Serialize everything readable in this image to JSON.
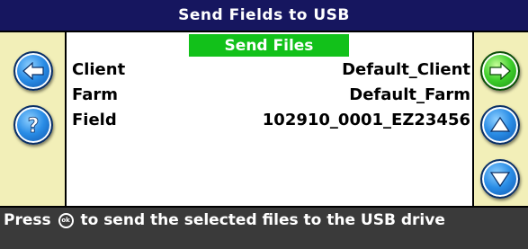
{
  "window": {
    "title": "Send Fields to USB"
  },
  "tab": {
    "label": "Send Files"
  },
  "rows": [
    {
      "label": "Client",
      "value": "Default_Client"
    },
    {
      "label": "Farm",
      "value": "Default_Farm"
    },
    {
      "label": "Field",
      "value": "102910_0001_EZ23456"
    }
  ],
  "status": {
    "text_before": "Press",
    "ok_icon_text": "ok",
    "text_after": "to send the selected files to the USB drive"
  },
  "buttons": {
    "back_icon": "arrow-left-icon",
    "help_icon": "question-mark-icon",
    "confirm_icon": "arrow-right-icon",
    "up_icon": "arrow-up-icon",
    "down_icon": "arrow-down-icon"
  },
  "colors": {
    "title_bar": "#16165f",
    "side_panel": "#f2efb8",
    "tab_green": "#12c11a",
    "status_bar": "#3a3a3a",
    "button_blue": "#2a8de6",
    "button_green": "#3fcf2c"
  }
}
